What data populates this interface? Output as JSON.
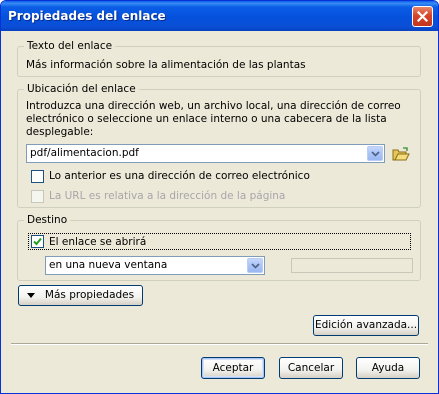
{
  "window": {
    "title": "Propiedades del enlace"
  },
  "link_text_group": {
    "title": "Texto del enlace",
    "value": "Más información sobre la alimentación de las plantas"
  },
  "location_group": {
    "title": "Ubicación del enlace",
    "instructions_line1": "Introduzca una dirección web, un archivo local, una dirección de correo",
    "instructions_line2": "electrónico o seleccione un enlace interno o una cabecera de la lista",
    "instructions_line3": "desplegable:",
    "url_value": "pdf/alimentacion.pdf",
    "email_checkbox_label": "Lo anterior es una dirección de correo electrónico",
    "email_checked": false,
    "relative_checkbox_label": "La URL es relativa a la dirección de la página",
    "relative_checked": false,
    "relative_enabled": false
  },
  "target_group": {
    "title": "Destino",
    "open_checkbox_label": "El enlace se abrirá",
    "open_checked": true,
    "target_select_value": "en una nueva ventana",
    "frame_name_value": ""
  },
  "buttons": {
    "more_properties": "Más propiedades",
    "advanced_edit": "Edición avanzada...",
    "accept": "Aceptar",
    "cancel": "Cancelar",
    "help": "Ayuda"
  },
  "icons": {
    "close": "close-icon",
    "folder": "open-folder-icon",
    "dropdown": "chevron-down-icon",
    "check": "checkmark-icon",
    "triangle": "triangle-down-icon"
  },
  "colors": {
    "titlebar": "#0551dc",
    "dialog_bg": "#ece9d8",
    "close_button": "#d6442a",
    "disabled_text": "#a7a6aa"
  }
}
